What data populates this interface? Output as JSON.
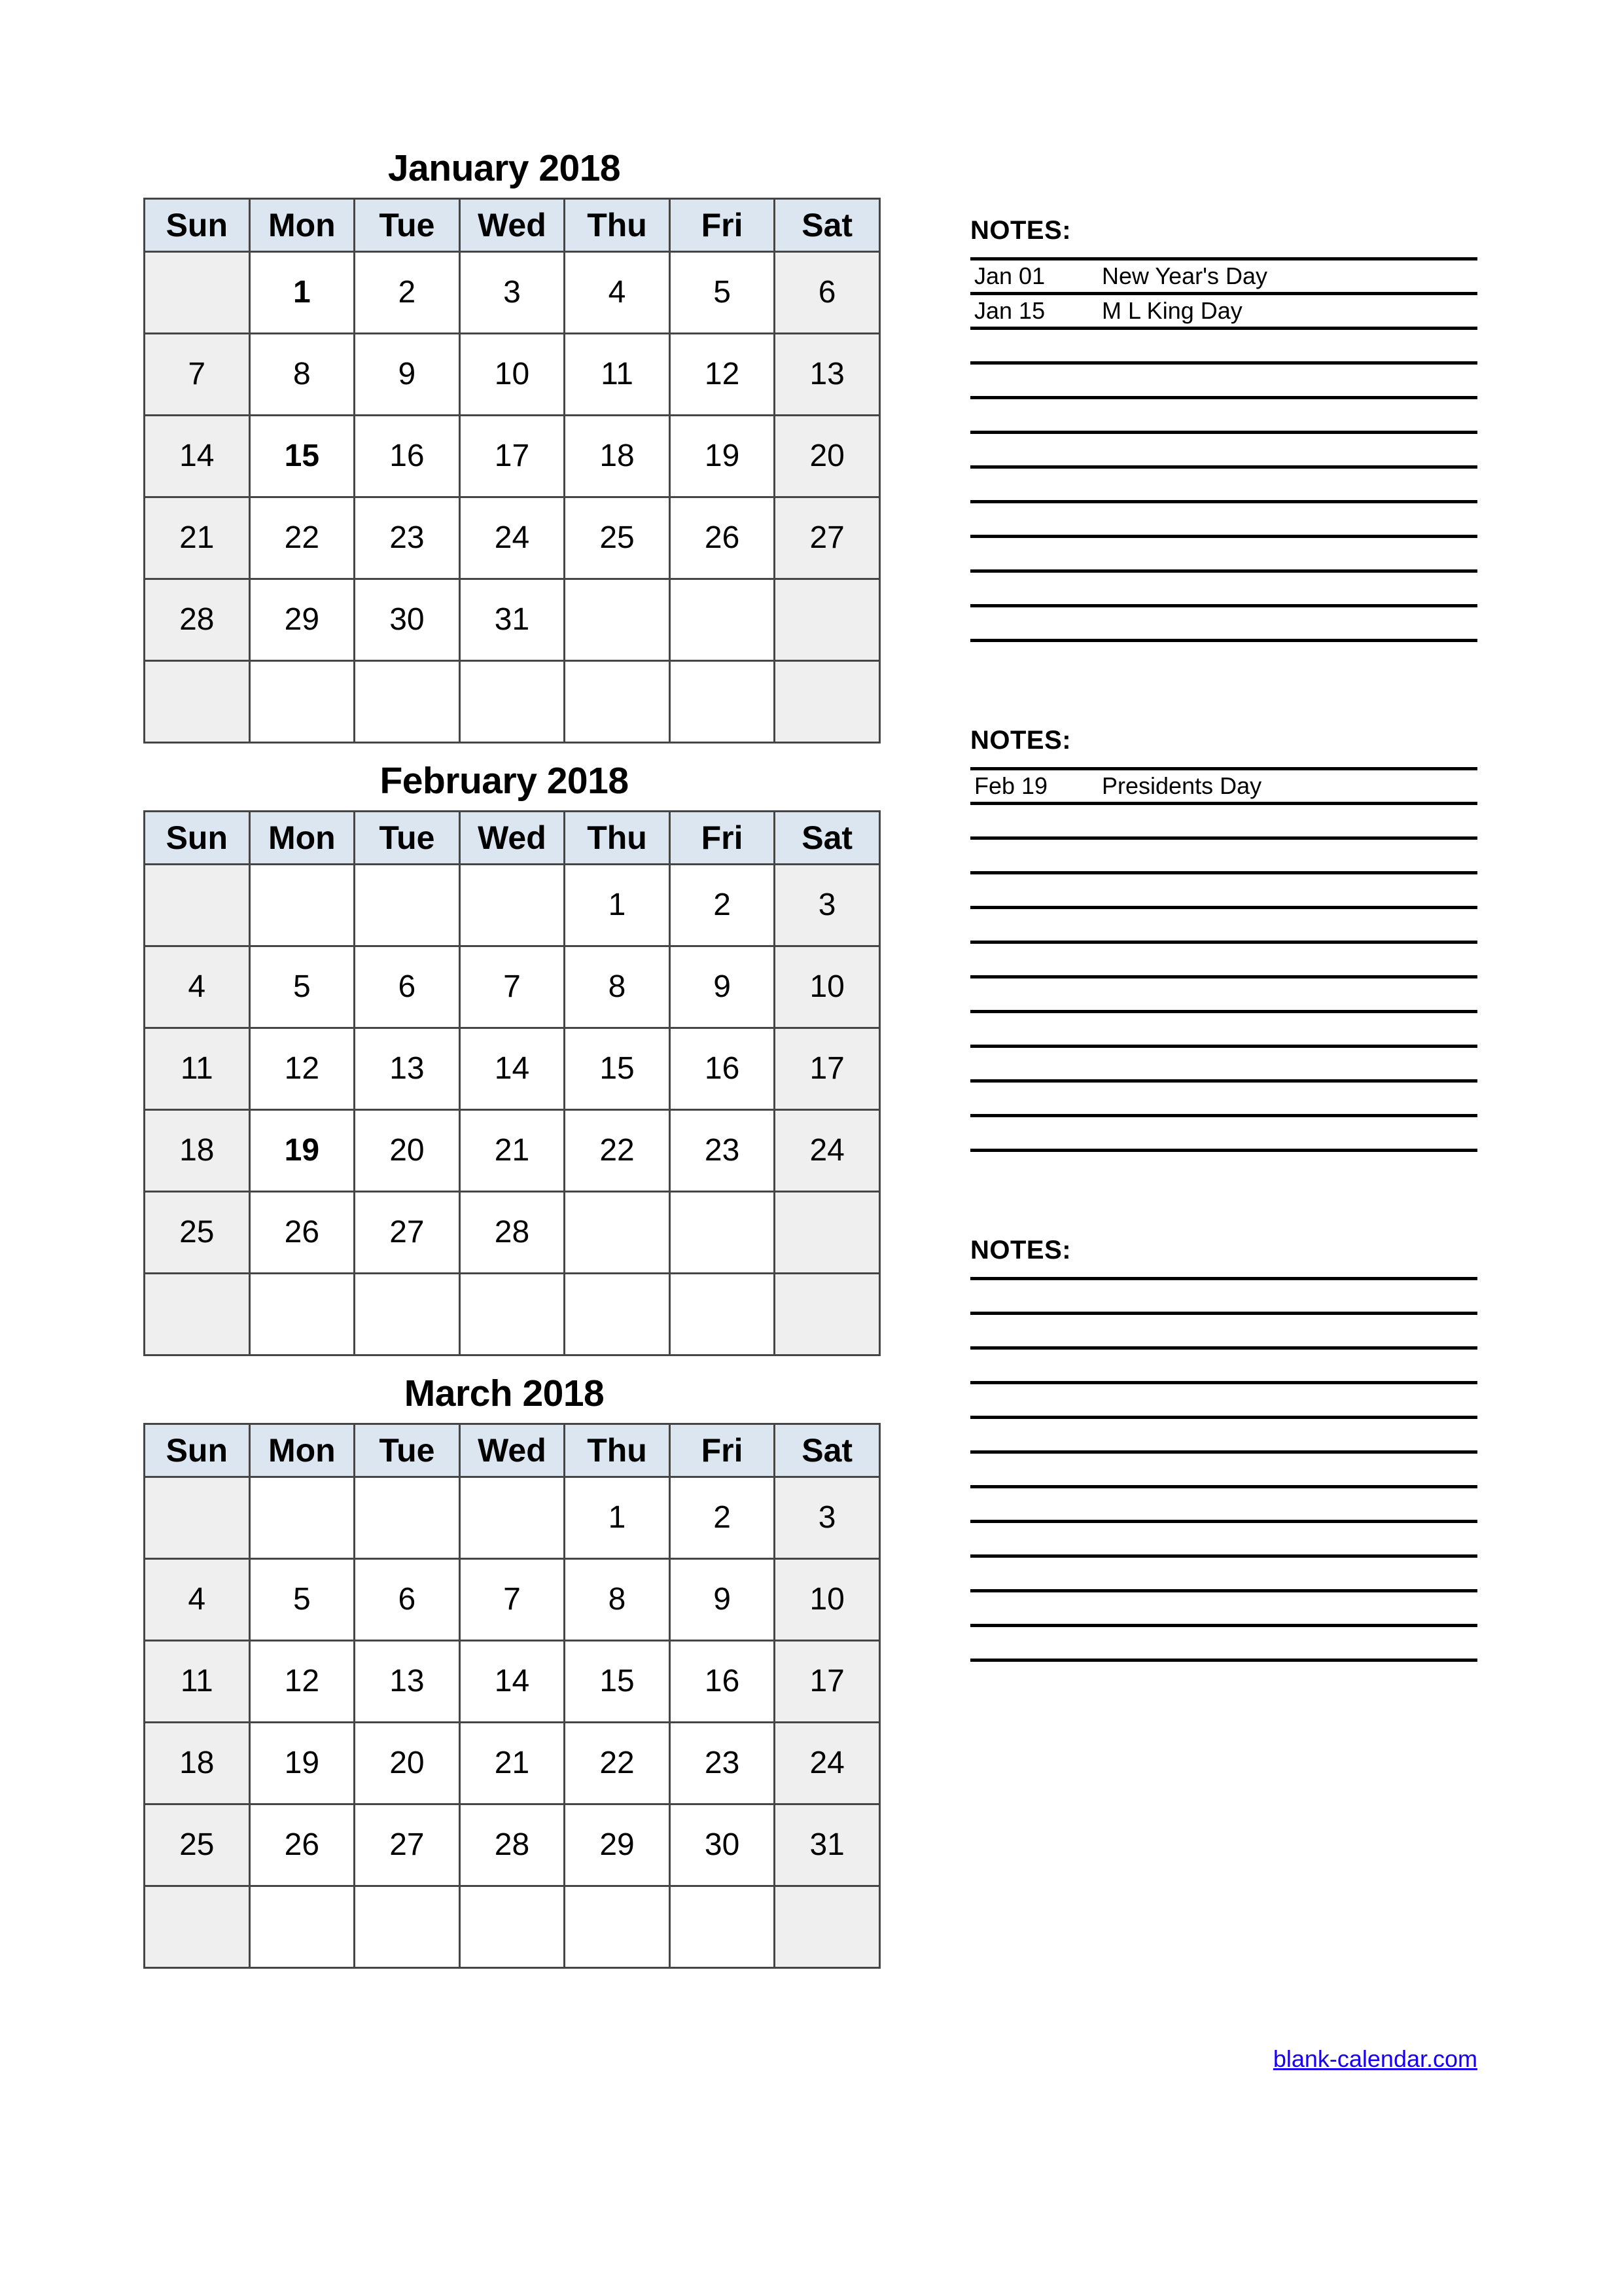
{
  "page": {
    "background": "#ffffff",
    "header_bg": "#dce6f1",
    "weekend_bg": "#efefef",
    "border_color": "#464646",
    "link_color": "#1800f0"
  },
  "weekdays": [
    "Sun",
    "Mon",
    "Tue",
    "Wed",
    "Thu",
    "Fri",
    "Sat"
  ],
  "notes_label": "NOTES:",
  "footer": {
    "link_text": "blank-calendar.com"
  },
  "months": [
    {
      "title": "January 2018",
      "weeks": [
        [
          "",
          "1",
          "2",
          "3",
          "4",
          "5",
          "6"
        ],
        [
          "7",
          "8",
          "9",
          "10",
          "11",
          "12",
          "13"
        ],
        [
          "14",
          "15",
          "16",
          "17",
          "18",
          "19",
          "20"
        ],
        [
          "21",
          "22",
          "23",
          "24",
          "25",
          "26",
          "27"
        ],
        [
          "28",
          "29",
          "30",
          "31",
          "",
          "",
          ""
        ],
        [
          "",
          "",
          "",
          "",
          "",
          "",
          ""
        ]
      ],
      "bold_days": [
        "1",
        "15"
      ]
    },
    {
      "title": "February 2018",
      "weeks": [
        [
          "",
          "",
          "",
          "",
          "1",
          "2",
          "3"
        ],
        [
          "4",
          "5",
          "6",
          "7",
          "8",
          "9",
          "10"
        ],
        [
          "11",
          "12",
          "13",
          "14",
          "15",
          "16",
          "17"
        ],
        [
          "18",
          "19",
          "20",
          "21",
          "22",
          "23",
          "24"
        ],
        [
          "25",
          "26",
          "27",
          "28",
          "",
          "",
          ""
        ],
        [
          "",
          "",
          "",
          "",
          "",
          "",
          ""
        ]
      ],
      "bold_days": [
        "19"
      ]
    },
    {
      "title": "March 2018",
      "weeks": [
        [
          "",
          "",
          "",
          "",
          "1",
          "2",
          "3"
        ],
        [
          "4",
          "5",
          "6",
          "7",
          "8",
          "9",
          "10"
        ],
        [
          "11",
          "12",
          "13",
          "14",
          "15",
          "16",
          "17"
        ],
        [
          "18",
          "19",
          "20",
          "21",
          "22",
          "23",
          "24"
        ],
        [
          "25",
          "26",
          "27",
          "28",
          "29",
          "30",
          "31"
        ],
        [
          "",
          "",
          "",
          "",
          "",
          "",
          ""
        ]
      ],
      "bold_days": []
    }
  ],
  "notes": [
    {
      "month": "January",
      "rows": [
        {
          "date": "Jan 01",
          "text": "New Year's Day"
        },
        {
          "date": "Jan 15",
          "text": "M L King Day"
        },
        {
          "date": "",
          "text": ""
        },
        {
          "date": "",
          "text": ""
        },
        {
          "date": "",
          "text": ""
        },
        {
          "date": "",
          "text": ""
        },
        {
          "date": "",
          "text": ""
        },
        {
          "date": "",
          "text": ""
        },
        {
          "date": "",
          "text": ""
        },
        {
          "date": "",
          "text": ""
        },
        {
          "date": "",
          "text": ""
        }
      ]
    },
    {
      "month": "February",
      "rows": [
        {
          "date": "Feb 19",
          "text": "Presidents Day"
        },
        {
          "date": "",
          "text": ""
        },
        {
          "date": "",
          "text": ""
        },
        {
          "date": "",
          "text": ""
        },
        {
          "date": "",
          "text": ""
        },
        {
          "date": "",
          "text": ""
        },
        {
          "date": "",
          "text": ""
        },
        {
          "date": "",
          "text": ""
        },
        {
          "date": "",
          "text": ""
        },
        {
          "date": "",
          "text": ""
        },
        {
          "date": "",
          "text": ""
        }
      ]
    },
    {
      "month": "March",
      "rows": [
        {
          "date": "",
          "text": ""
        },
        {
          "date": "",
          "text": ""
        },
        {
          "date": "",
          "text": ""
        },
        {
          "date": "",
          "text": ""
        },
        {
          "date": "",
          "text": ""
        },
        {
          "date": "",
          "text": ""
        },
        {
          "date": "",
          "text": ""
        },
        {
          "date": "",
          "text": ""
        },
        {
          "date": "",
          "text": ""
        },
        {
          "date": "",
          "text": ""
        },
        {
          "date": "",
          "text": ""
        }
      ]
    }
  ]
}
